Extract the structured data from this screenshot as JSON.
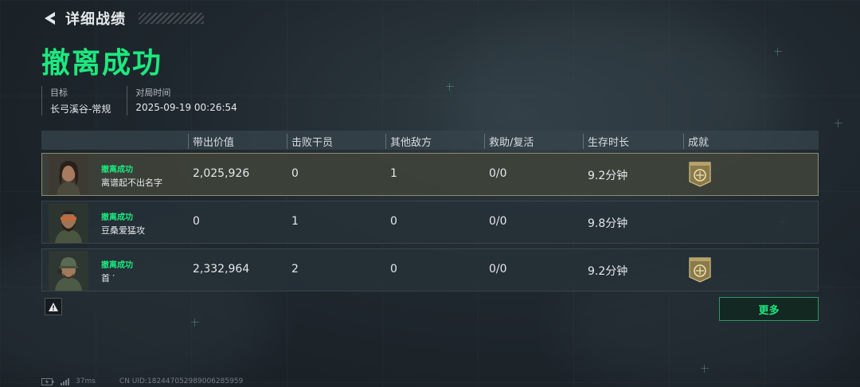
{
  "header": {
    "title": "详细战绩",
    "back_icon": "back-arrow-icon"
  },
  "result": {
    "title": "撤离成功",
    "color": "#1de87f"
  },
  "info": {
    "target_label": "目标",
    "target_value": "长弓溪谷-常规",
    "time_label": "对局时间",
    "time_value": "2025-09-19 00:26:54"
  },
  "table": {
    "headers": [
      "带出价值",
      "击败干员",
      "其他敌方",
      "救助/复活",
      "生存时长",
      "成就"
    ],
    "rows": [
      {
        "status": "撤离成功",
        "name": "离谱起不出名字",
        "value": "2,025,926",
        "kills": "0",
        "other": "1",
        "assist": "0/0",
        "survival": "9.2分钟",
        "achievement": true,
        "selected": true
      },
      {
        "status": "撤离成功",
        "name": "豆桑爱猛攻",
        "value": "0",
        "kills": "1",
        "other": "0",
        "assist": "0/0",
        "survival": "9.8分钟",
        "achievement": false,
        "selected": false
      },
      {
        "status": "撤离成功",
        "name": "首 ′",
        "value": "2,332,964",
        "kills": "2",
        "other": "0",
        "assist": "0/0",
        "survival": "9.2分钟",
        "achievement": true,
        "selected": false
      }
    ]
  },
  "buttons": {
    "more": "更多",
    "warn_icon": "warning-icon"
  },
  "footer": {
    "ping": "37ms",
    "uid": "CN UID:18244705298900628595​9"
  }
}
